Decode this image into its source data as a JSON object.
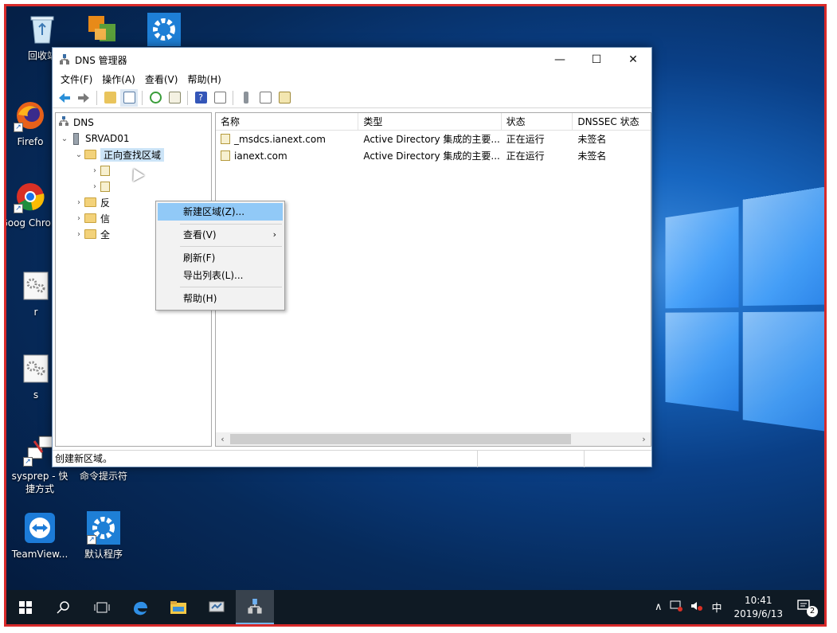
{
  "desktop": {
    "icons": [
      {
        "label": "回收站",
        "icon": "recycle-bin-icon"
      },
      {
        "label": "",
        "icon": "app-icon"
      },
      {
        "label": "",
        "icon": "gear-icon"
      },
      {
        "label": "Firefo",
        "icon": "firefox-icon"
      },
      {
        "label": "Goog Chrom",
        "icon": "chrome-icon"
      },
      {
        "label": "r",
        "icon": "settings-file-icon"
      },
      {
        "label": "s",
        "icon": "settings-file-icon"
      },
      {
        "label": "sysprep - 快捷方式",
        "icon": "sysprep-icon"
      },
      {
        "label": "命令提示符",
        "icon": "cmd-icon"
      },
      {
        "label": "TeamView...",
        "icon": "teamviewer-icon"
      },
      {
        "label": "默认程序",
        "icon": "gear-icon"
      }
    ]
  },
  "window": {
    "title": "DNS 管理器",
    "controls": {
      "minimize": "—",
      "maximize": "☐",
      "close": "✕"
    },
    "menus": [
      "文件(F)",
      "操作(A)",
      "查看(V)",
      "帮助(H)"
    ],
    "tree": {
      "root": "DNS",
      "server": "SRVAD01",
      "forward_zones": "正向查找区域",
      "partial": [
        "反",
        "信",
        "全"
      ]
    },
    "list": {
      "columns": [
        "名称",
        "类型",
        "状态",
        "DNSSEC 状态"
      ],
      "rows": [
        {
          "name": "_msdcs.ianext.com",
          "type": "Active Directory 集成的主要...",
          "status": "正在运行",
          "dnssec": "未签名"
        },
        {
          "name": "ianext.com",
          "type": "Active Directory 集成的主要...",
          "status": "正在运行",
          "dnssec": "未签名"
        }
      ]
    },
    "status": "创建新区域。"
  },
  "context_menu": {
    "items": [
      "新建区域(Z)...",
      "查看(V)",
      "刷新(F)",
      "导出列表(L)...",
      "帮助(H)"
    ],
    "submenu_arrow": "›"
  },
  "taskbar": {
    "lang": "中",
    "time": "10:41",
    "date": "2019/6/13",
    "notifications": "2"
  }
}
